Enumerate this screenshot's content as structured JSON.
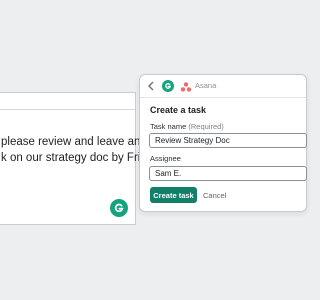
{
  "document": {
    "lines": [
      "please review and leave any",
      "k on our strategy doc by Friday?"
    ]
  },
  "panel": {
    "app_name": "Asana",
    "title": "Create a task",
    "task_name_label": "Task name",
    "task_name_required": "(Required)",
    "task_name_value": "Review Strategy Doc",
    "assignee_label": "Assignee",
    "assignee_value": "Sam E.",
    "create_label": "Create task",
    "cancel_label": "Cancel"
  },
  "colors": {
    "grammarly_green": "#15a37f",
    "create_button": "#128069",
    "asana_coral": "#f06a6a"
  },
  "icons": {
    "back": "chevron-left-icon",
    "grammarly": "grammarly-icon",
    "asana": "asana-icon"
  }
}
